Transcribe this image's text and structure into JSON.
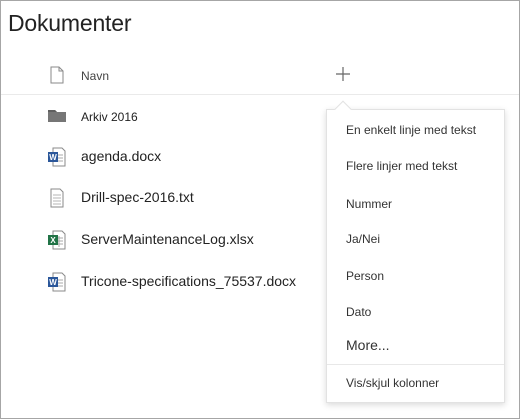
{
  "page": {
    "title": "Dokumenter"
  },
  "header": {
    "name_column": "Navn",
    "add_column_symbol": "+"
  },
  "files": [
    {
      "name": "Arkiv 2016",
      "icon": "folder-icon"
    },
    {
      "name": "agenda.docx",
      "icon": "word-doc-icon"
    },
    {
      "name": "Drill-spec-2016.txt",
      "icon": "text-file-icon"
    },
    {
      "name": "ServerMaintenanceLog.xlsx",
      "icon": "excel-doc-icon"
    },
    {
      "name": "Tricone-specifications_75537.docx",
      "icon": "word-doc-icon"
    }
  ],
  "column_menu": {
    "items": [
      "En enkelt linje med tekst",
      "Flere linjer med tekst",
      "Nummer",
      "Ja/Nei",
      "Person",
      "Dato",
      "More..."
    ],
    "footer_item": "Vis/skjul kolonner"
  },
  "colors": {
    "word_blue": "#2b579a",
    "excel_green": "#217346",
    "folder_gray": "#767676"
  }
}
